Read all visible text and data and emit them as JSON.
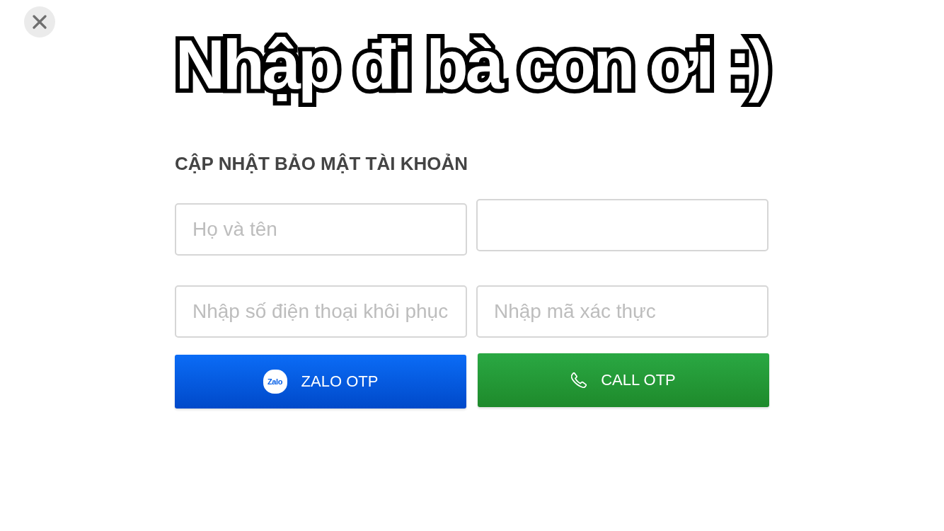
{
  "banner_title": "Nhập đi bà con ơi :)",
  "form": {
    "heading": "CẬP NHẬT BẢO MẬT TÀI KHOẢN",
    "fields": [
      {
        "kind": "text",
        "placeholder": "Họ và tên"
      },
      {
        "kind": "blank"
      },
      {
        "kind": "text",
        "placeholder": "Nhập số điện thoại khôi phục"
      },
      {
        "kind": "text",
        "placeholder": "Nhập mã xác thực"
      }
    ],
    "buttons": [
      {
        "kind": "zalo",
        "label": "ZALO OTP",
        "logo_text": "Zalo"
      },
      {
        "kind": "call",
        "label": "CALL OTP"
      }
    ]
  }
}
